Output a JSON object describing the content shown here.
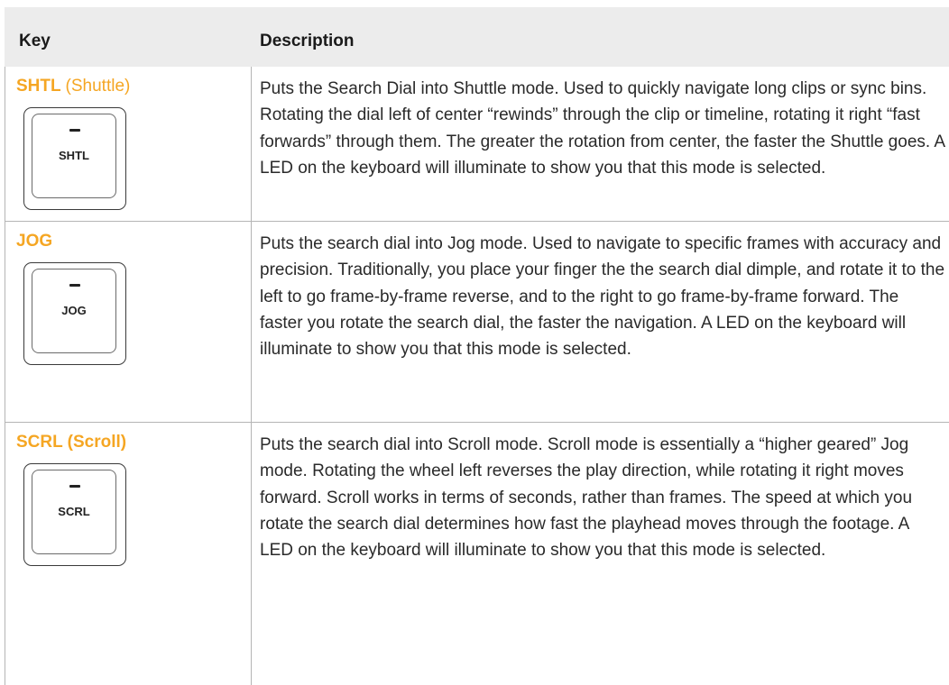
{
  "header": {
    "key_label": "Key",
    "description_label": "Description"
  },
  "rows": [
    {
      "key_name": "SHTL",
      "key_paren": "(Shuttle)",
      "cap_label": "SHTL",
      "description": "Puts the Search Dial into Shuttle mode. Used to quickly navigate long clips or sync bins. Rotating the dial left of center “rewinds” through the clip or timeline, rotating it right “fast forwards” through them. The greater the rotation from center, the faster the Shuttle goes. A LED on the keyboard will illuminate to show you that this mode is selected."
    },
    {
      "key_name": "JOG",
      "key_paren": "",
      "cap_label": "JOG",
      "description": "Puts the search dial into Jog mode. Used to navigate to specific frames with accuracy and precision. Traditionally, you place your finger the the search dial dimple, and rotate it to the left to go frame-by-frame reverse, and to the right to go frame-by-frame forward. The faster you rotate the search dial, the faster the navigation. A LED on the keyboard will illuminate to show you that this mode is selected."
    },
    {
      "key_name": "SCRL (Scroll)",
      "key_paren": "",
      "cap_label": "SCRL",
      "description": "Puts the search dial into Scroll mode. Scroll mode is essentially a “higher geared” Jog mode. Rotating the wheel left reverses the play direction, while rotating it right moves forward. Scroll works in terms of seconds, rather than frames. The speed at which you rotate the search dial determines how fast the playhead moves through the footage. A LED on the keyboard will illuminate to show you that this mode is selected."
    }
  ],
  "colors": {
    "accent": "#f5a623",
    "header_bg": "#ececec",
    "border": "#b5b5b5"
  }
}
